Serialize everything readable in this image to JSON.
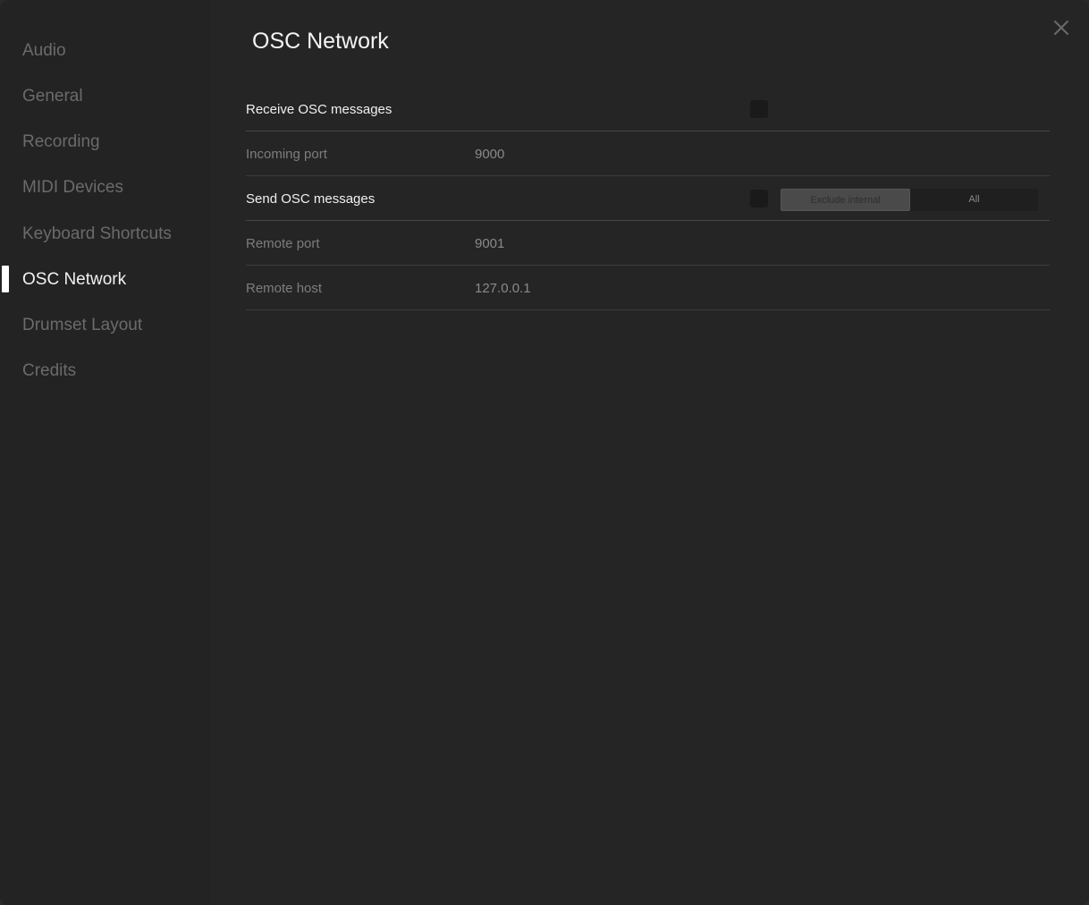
{
  "sidebar": {
    "items": [
      {
        "label": "Audio"
      },
      {
        "label": "General"
      },
      {
        "label": "Recording"
      },
      {
        "label": "MIDI Devices"
      },
      {
        "label": "Keyboard Shortcuts"
      },
      {
        "label": "OSC Network"
      },
      {
        "label": "Drumset Layout"
      },
      {
        "label": "Credits"
      }
    ],
    "active": "OSC Network"
  },
  "header": {
    "title": "OSC Network",
    "close_icon": "close-icon"
  },
  "settings": {
    "receive": {
      "label": "Receive OSC messages",
      "checked": false
    },
    "incoming_port": {
      "label": "Incoming port",
      "value": "9000"
    },
    "send": {
      "label": "Send OSC messages",
      "checked": false,
      "options": [
        "Exclude internal",
        "All"
      ],
      "selected": "Exclude internal"
    },
    "remote_port": {
      "label": "Remote port",
      "value": "9001"
    },
    "remote_host": {
      "label": "Remote host",
      "value": "127.0.0.1"
    }
  },
  "colors": {
    "background": "#252525",
    "sidebar": "#232323",
    "active_indicator": "#ffffff"
  }
}
